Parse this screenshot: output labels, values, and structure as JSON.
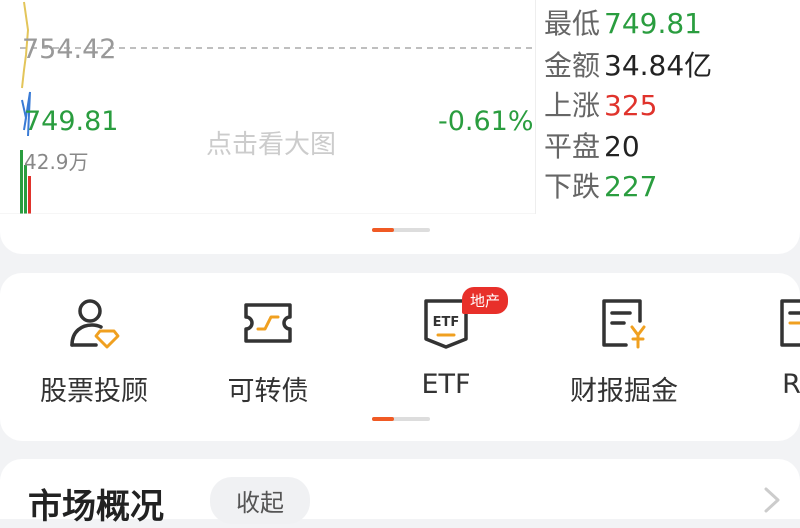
{
  "chart": {
    "ref_price": "754.42",
    "current_price": "749.81",
    "volume": "42.9万",
    "change_pct": "-0.61%",
    "hint": "点击看大图"
  },
  "stats": [
    {
      "label": "最低",
      "value": "749.81",
      "color": "#2a9d3f"
    },
    {
      "label": "金额",
      "value": "34.84亿",
      "color": "#222222"
    },
    {
      "label": "上涨",
      "value": "325",
      "color": "#e0332c"
    },
    {
      "label": "平盘",
      "value": "20",
      "color": "#222222"
    },
    {
      "label": "下跌",
      "value": "227",
      "color": "#2a9d3f"
    }
  ],
  "features": [
    {
      "label": "股票投顾",
      "icon": "advisor-person-icon"
    },
    {
      "label": "可转债",
      "icon": "convertible-bond-ticket-icon"
    },
    {
      "label": "ETF",
      "icon": "etf-document-icon",
      "badge": "地产"
    },
    {
      "label": "财报掘金",
      "icon": "financial-report-yen-icon"
    },
    {
      "label": "RE",
      "icon": "report-icon"
    }
  ],
  "overview": {
    "title": "市场概况",
    "collapse_label": "收起"
  },
  "colors": {
    "up": "#e0332c",
    "down": "#2a9d3f",
    "accent": "#f05a24"
  }
}
